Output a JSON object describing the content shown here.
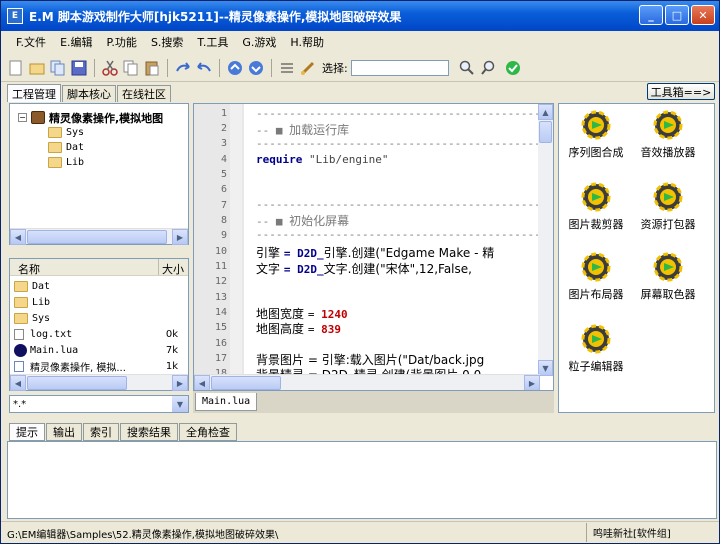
{
  "window": {
    "title": "E.M 脚本游戏制作大师[hjk5211]--精灵像素操作,模拟地图破碎效果",
    "app_icon_text": "E"
  },
  "menu": [
    "F.文件",
    "E.编辑",
    "P.功能",
    "S.搜索",
    "T.工具",
    "G.游戏",
    "H.帮助"
  ],
  "toolbar": {
    "select_label": "选择:",
    "select_value": "",
    "icons": [
      "new-file-icon",
      "open-folder-icon",
      "copy-pages-icon",
      "save-icon",
      "cut-icon",
      "copy-icon",
      "paste-icon",
      "redo-icon",
      "undo-icon",
      "arrow-up-icon",
      "arrow-down-icon",
      "list-icon",
      "brush-icon",
      "search-icon",
      "search-next-icon",
      "check-icon"
    ]
  },
  "left_tabs": [
    "工程管理",
    "脚本核心",
    "在线社区"
  ],
  "toolbox_button": "工具箱==>",
  "tree": {
    "root": "精灵像素操作,模拟地图",
    "children": [
      "Sys",
      "Dat",
      "Lib"
    ]
  },
  "filelist": {
    "headers": {
      "name": "名称",
      "size": "大小"
    },
    "rows": [
      {
        "name": "Dat",
        "size": "",
        "icon": "folder-icon"
      },
      {
        "name": "Lib",
        "size": "",
        "icon": "folder-icon"
      },
      {
        "name": "Sys",
        "size": "",
        "icon": "folder-icon"
      },
      {
        "name": "log.txt",
        "size": "0k",
        "icon": "text-file-icon"
      },
      {
        "name": "Main.lua",
        "size": "7k",
        "icon": "lua-file-icon"
      },
      {
        "name": "精灵像素操作, 模拟...",
        "size": "1k",
        "icon": "doc-file-icon"
      }
    ],
    "filter": "*.*"
  },
  "editor": {
    "line_numbers": [
      "1",
      "2",
      "3",
      "4",
      "5",
      "6",
      "7",
      "8",
      "9",
      "10",
      "11",
      "12",
      "13",
      "14",
      "15",
      "16",
      "17",
      "18"
    ],
    "lines": {
      "l1": "-------------------------------------------",
      "l2_prefix": "-- ■ ",
      "l2_text": "加载运行库",
      "l3": "-------------------------------------------",
      "l4_kw": "require",
      "l4_str": " \"Lib/engine\"",
      "l7": "-------------------------------------------",
      "l8_prefix": "-- ■ ",
      "l8_text": "初始化屏幕",
      "l9": "-------------------------------------------",
      "l10_a": "引擎 ",
      "l10_b": "= D2D_",
      "l10_c": "引擎.创建(\"Edgame Make - 精",
      "l11_a": "文字 ",
      "l11_b": "= D2D_",
      "l11_c": "文字.创建(\"宋体\",12,False,",
      "l14_a": "地图宽度 ",
      "l14_b": "= ",
      "l14_num": "1240",
      "l15_a": "地图高度 ",
      "l15_b": "= ",
      "l15_num": "839",
      "l17_a": "背景图片 ",
      "l17_b": "= 引擎:载入图片(\"Dat/back.jpg",
      "l18_a": "背景精灵 ",
      "l18_b": "= D2D_精灵.创建(背景图片,0,0"
    },
    "file_tab": "Main.lua"
  },
  "toolbox": {
    "items": [
      "序列图合成",
      "音效播放器",
      "图片裁剪器",
      "资源打包器",
      "图片布局器",
      "屏幕取色器",
      "粒子编辑器"
    ]
  },
  "bottom_tabs": [
    "提示",
    "输出",
    "索引",
    "搜索结果",
    "全角检查"
  ],
  "status": {
    "path": "G:\\EM编辑器\\Samples\\52.精灵像素操作,模拟地图破碎效果\\",
    "right": "鸣哇新社[软件组]"
  },
  "colors": {
    "title_bar": "#0a5ed8",
    "gear_yellow": "#f2c200",
    "gear_dark": "#3c3c3c",
    "gear_green": "#2fb84a"
  }
}
